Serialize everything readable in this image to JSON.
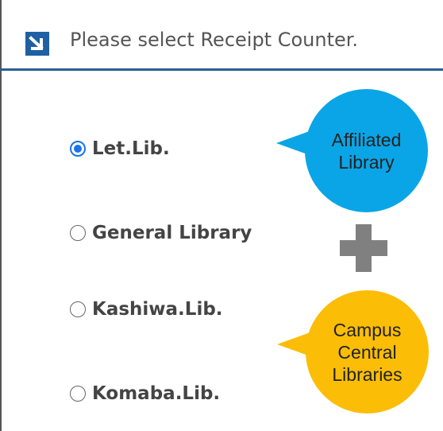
{
  "header": {
    "icon": "arrow-down-right-icon",
    "title": "Please select Receipt Counter."
  },
  "counters": {
    "selected": "Let.Lib.",
    "options": [
      {
        "label": "Let.Lib.",
        "checked": true
      },
      {
        "label": "General Library",
        "checked": false
      },
      {
        "label": "Kashiwa.Lib.",
        "checked": false
      },
      {
        "label": "Komaba.Lib.",
        "checked": false
      }
    ]
  },
  "callouts": {
    "affiliated": {
      "line1": "Affiliated",
      "line2": "Library",
      "color": "#0aa5e6"
    },
    "central": {
      "line1": "Campus",
      "line2": "Central",
      "line3": "Libraries",
      "color": "#fbbd06"
    },
    "plus_icon": "plus-icon",
    "plus_color": "#808080"
  },
  "colors": {
    "accent": "#1f5fa3",
    "radio_selected": "#1a73e8"
  }
}
